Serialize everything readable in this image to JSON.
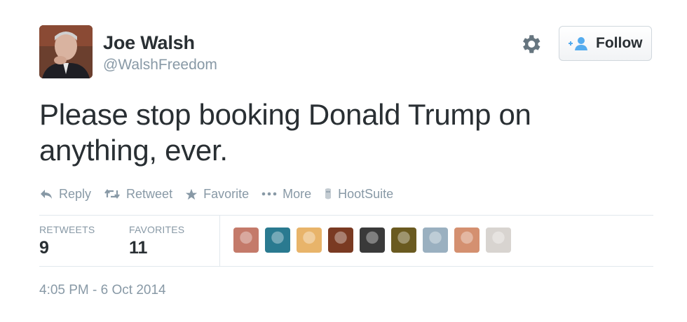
{
  "user": {
    "display_name": "Joe Walsh",
    "handle": "@WalshFreedom"
  },
  "follow_button": {
    "label": "Follow",
    "icon": "add-user-icon",
    "accent_color": "#55acee"
  },
  "settings": {
    "icon": "gear-icon"
  },
  "tweet": {
    "text_line1": "Please stop booking Donald Trump on",
    "text_line2": "anything, ever."
  },
  "actions": [
    {
      "label": "Reply",
      "icon": "reply-icon"
    },
    {
      "label": "Retweet",
      "icon": "retweet-icon"
    },
    {
      "label": "Favorite",
      "icon": "star-icon"
    },
    {
      "label": "More",
      "icon": "ellipsis-icon"
    },
    {
      "label": "HootSuite",
      "icon": "hootsuite-icon"
    }
  ],
  "stats": {
    "retweets_label": "RETWEETS",
    "retweets_count": "9",
    "favorites_label": "FAVORITES",
    "favorites_count": "11"
  },
  "favoriter_avatars": [
    {
      "name": "favoriter-avatar-1",
      "color": "#c47a6a"
    },
    {
      "name": "favoriter-avatar-2",
      "color": "#2a7a90"
    },
    {
      "name": "favoriter-avatar-3",
      "color": "#e8b46a"
    },
    {
      "name": "favoriter-avatar-4",
      "color": "#7a3a22"
    },
    {
      "name": "favoriter-avatar-5",
      "color": "#3a3a3a"
    },
    {
      "name": "favoriter-avatar-6",
      "color": "#6a5a20"
    },
    {
      "name": "favoriter-avatar-7",
      "color": "#9ab0c0"
    },
    {
      "name": "favoriter-avatar-8",
      "color": "#d49070"
    },
    {
      "name": "favoriter-avatar-9",
      "color": "#d8d4d0"
    }
  ],
  "timestamp": "4:05 PM - 6 Oct 2014",
  "colors": {
    "text": "#292f33",
    "muted": "#8899a6",
    "divider": "#e1e8ed"
  }
}
